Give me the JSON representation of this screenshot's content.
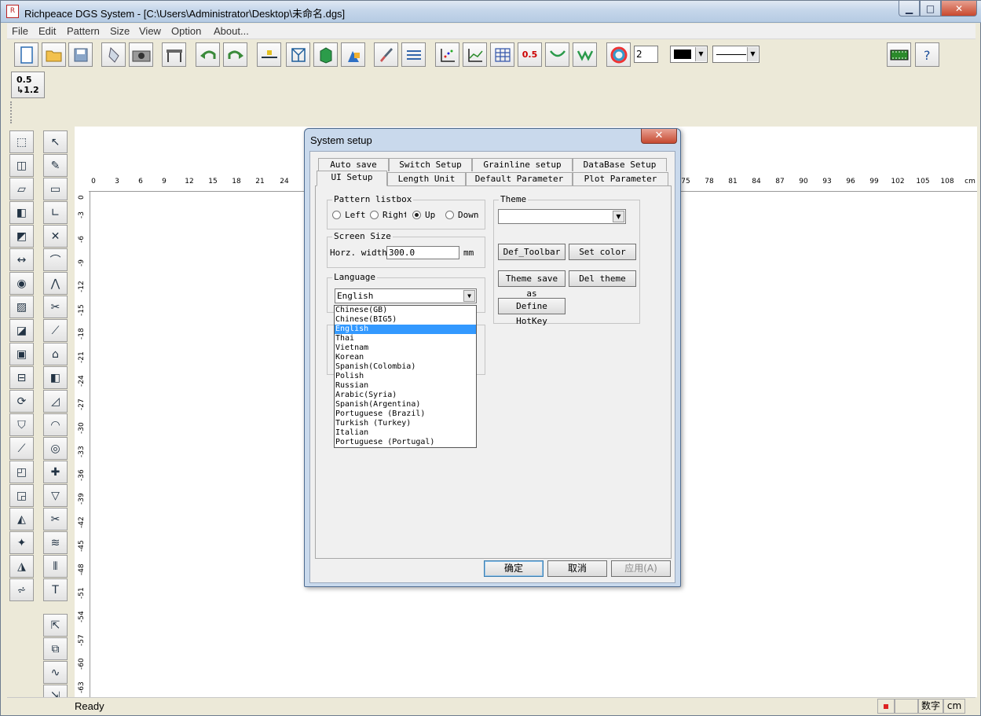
{
  "window": {
    "title": "Richpeace DGS System - [C:\\Users\\Administrator\\Desktop\\未命名.dgs]",
    "icon_text": "R",
    "minimize_label": "▁",
    "maximize_label": "□",
    "close_label": "✕"
  },
  "menu": [
    "File",
    "Edit",
    "Pattern",
    "Size",
    "View",
    "Option",
    "About..."
  ],
  "toolbar": {
    "line_width_value": "2",
    "scale_label_top": "0.5",
    "scale_label_bottom": "↳1.2",
    "mark_label": "0.5"
  },
  "ruler": {
    "top": [
      "0",
      "3",
      "6",
      "9",
      "12",
      "15",
      "18",
      "21",
      "24",
      "75",
      "78",
      "81",
      "84",
      "87",
      "90",
      "93",
      "96",
      "99",
      "102",
      "105",
      "108",
      "cm"
    ],
    "left": [
      "0",
      "-3",
      "-6",
      "-9",
      "-12",
      "-15",
      "-18",
      "-21",
      "-24",
      "-27",
      "-30",
      "-33",
      "-36",
      "-39",
      "-42",
      "-45",
      "-48",
      "-51",
      "-54",
      "-57",
      "-60",
      "-63"
    ]
  },
  "status": {
    "text": "Ready",
    "cell_ime": "数字",
    "cell_unit": "cm"
  },
  "dialog": {
    "title": "System setup",
    "close_label": "✕",
    "tabs_back": [
      "Auto save",
      "Switch Setup",
      "Grainline setup",
      "DataBase  Setup"
    ],
    "tabs_front": [
      "UI Setup",
      "Length Unit",
      "Default Parameter",
      "Plot Parameter"
    ],
    "pattern_listbox": {
      "title": "Pattern listbox",
      "options": [
        "Left",
        "Right",
        "Up",
        "Down"
      ],
      "selected": "Up"
    },
    "screen_size": {
      "title": "Screen Size",
      "label": "Horz. width",
      "value": "300.0",
      "unit": "mm"
    },
    "language": {
      "title": "Language",
      "selected": "English",
      "options": [
        "Chinese(GB)",
        "Chinese(BIG5)",
        "English",
        "Thai",
        "Vietnam",
        "Korean",
        "Spanish(Colombia)",
        "Polish",
        "Russian",
        "Arabic(Syria)",
        "Spanish(Argentina)",
        "Portuguese (Brazil)",
        "Turkish (Turkey)",
        "Italian",
        "Portuguese (Portugal)"
      ]
    },
    "theme": {
      "title": "Theme",
      "value": "",
      "buttons": [
        "Def_Toolbar",
        "Set color",
        "Theme save as",
        "Del theme",
        "Define HotKey"
      ]
    },
    "ok_label": "确定",
    "cancel_label": "取消",
    "apply_label": "应用(A)"
  },
  "colors": {
    "accent": "#3399ff",
    "titlebar": "#c5d6ea",
    "close": "#c8482e"
  }
}
